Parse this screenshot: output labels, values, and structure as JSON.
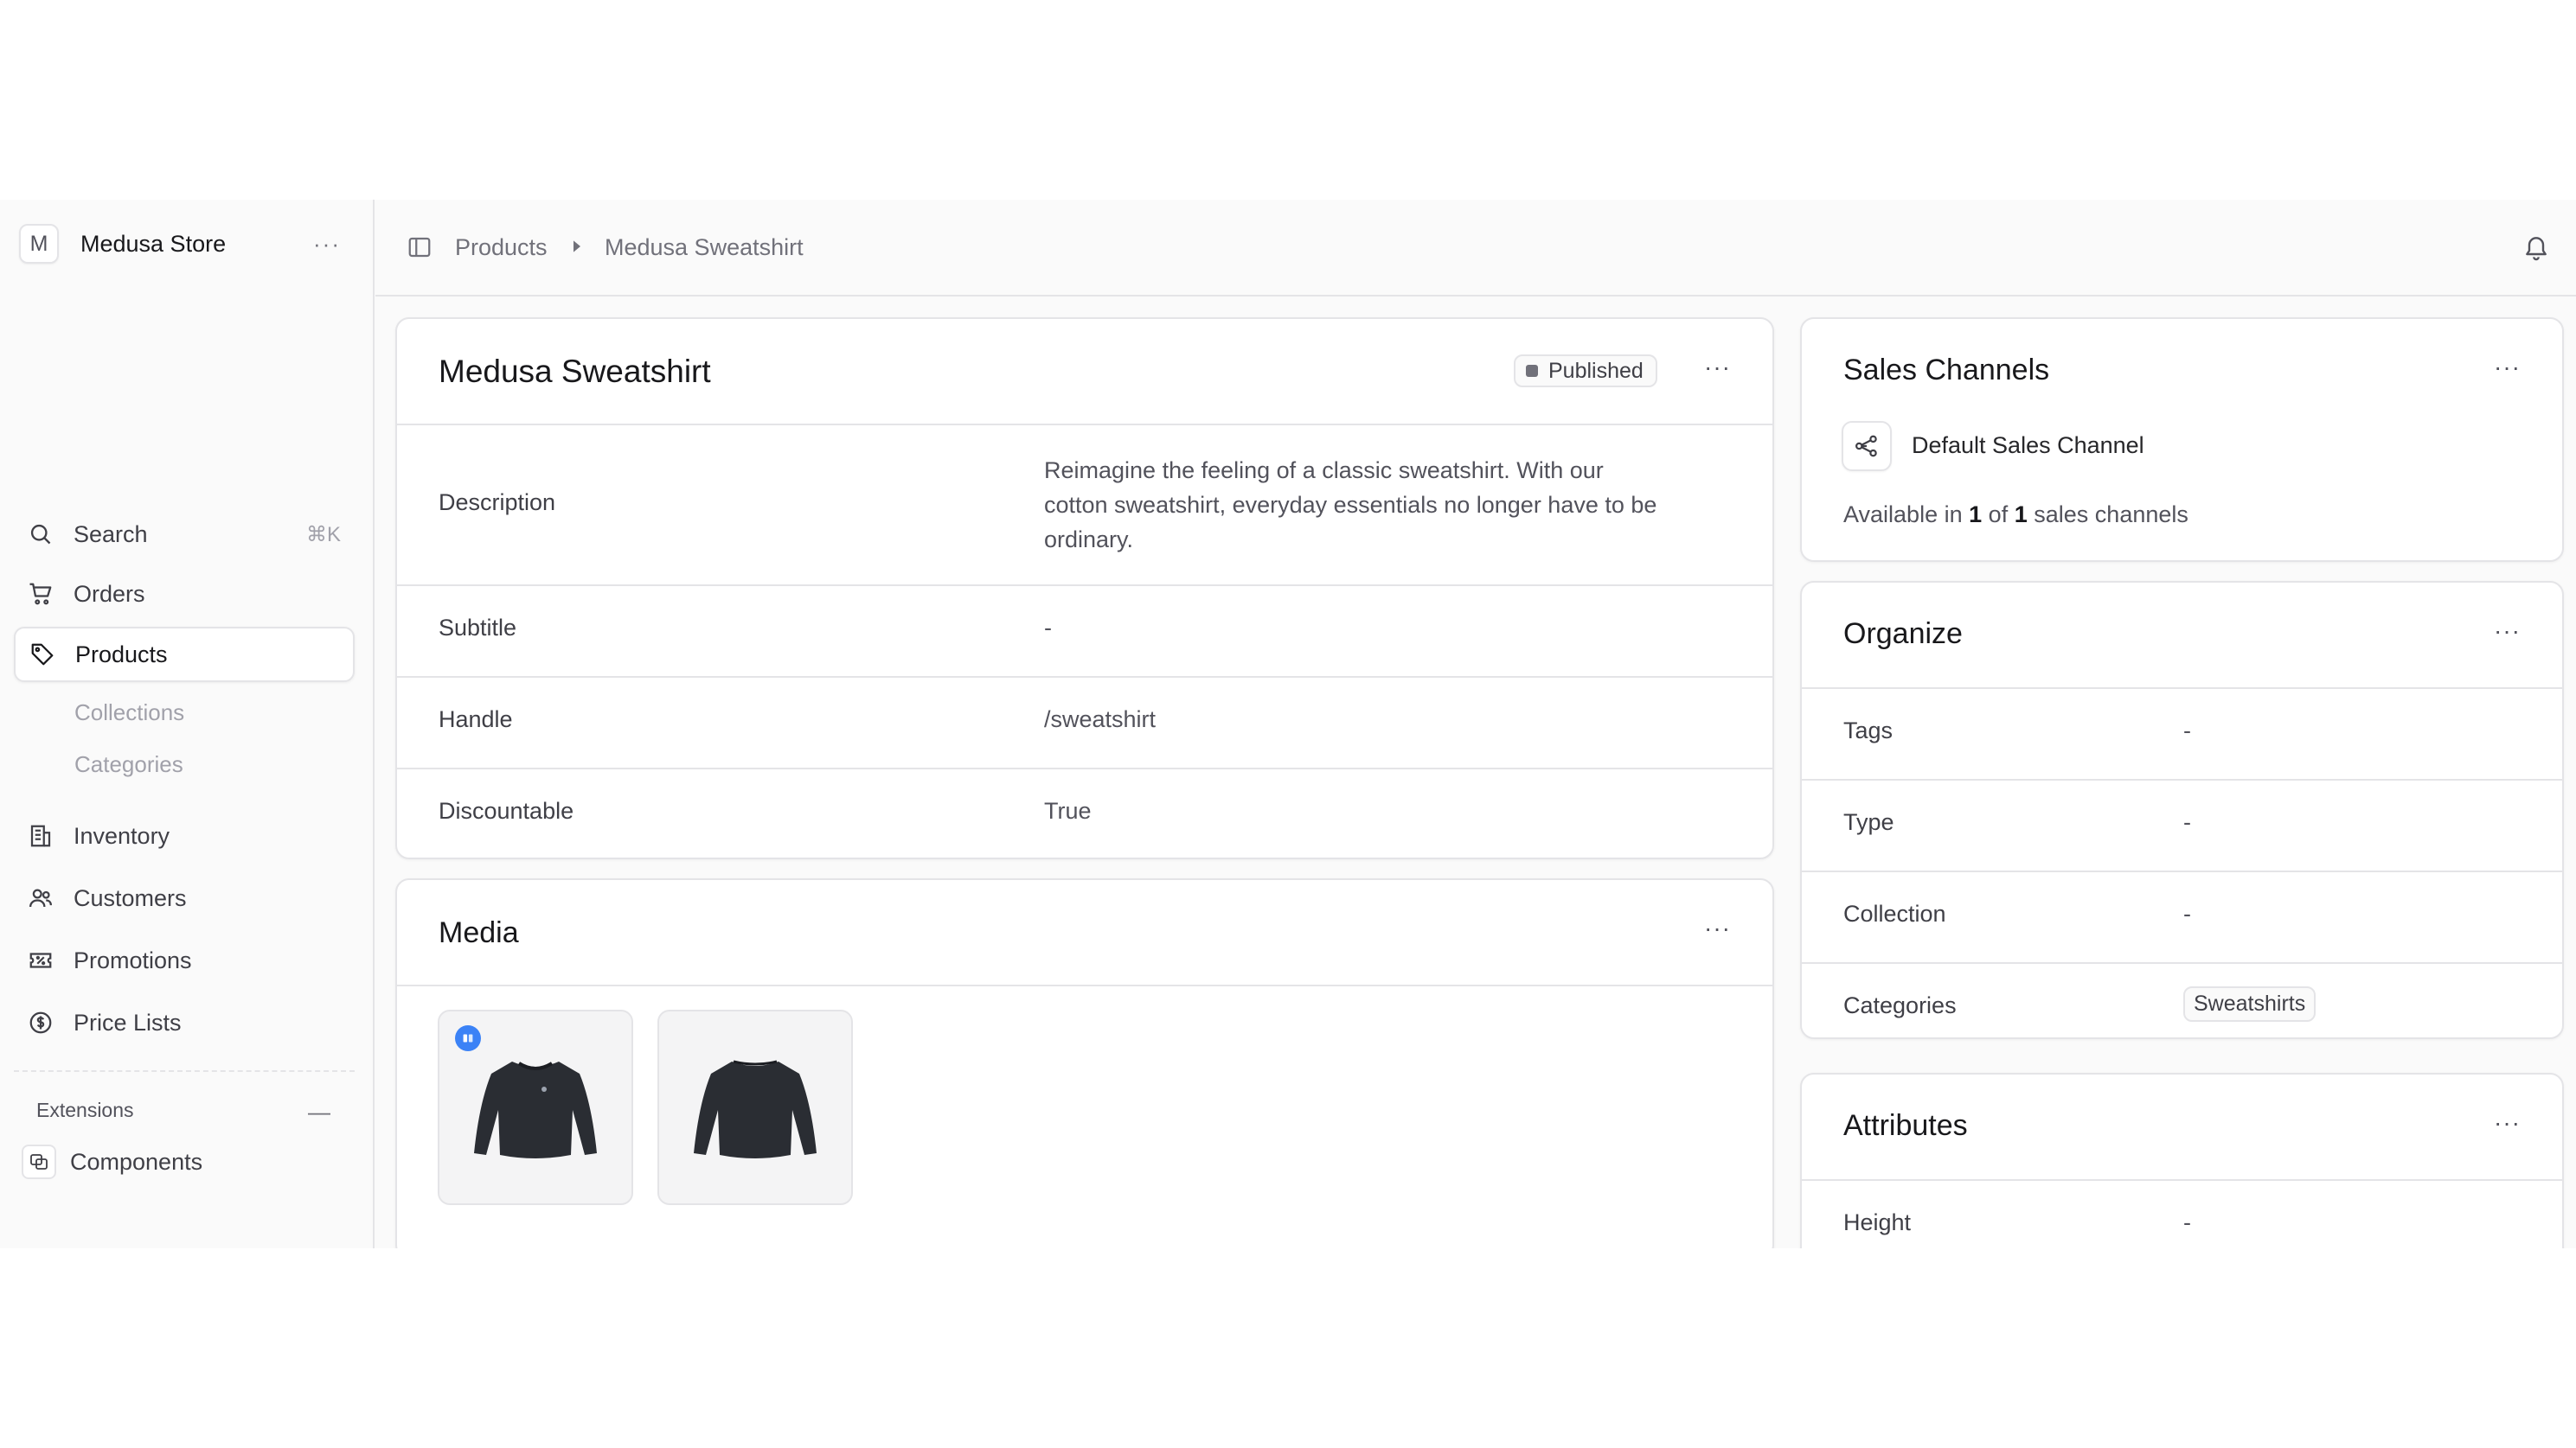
{
  "sidebar": {
    "store": {
      "initial": "M",
      "name": "Medusa Store"
    },
    "search": {
      "label": "Search",
      "shortcut": "⌘K"
    },
    "items": [
      {
        "label": "Orders",
        "icon": "cart-icon"
      },
      {
        "label": "Products",
        "icon": "tag-icon",
        "active": true
      },
      {
        "label": "Inventory",
        "icon": "building-icon"
      },
      {
        "label": "Customers",
        "icon": "users-icon"
      },
      {
        "label": "Promotions",
        "icon": "receipt-percent-icon"
      },
      {
        "label": "Price Lists",
        "icon": "currency-dollar-icon"
      }
    ],
    "product_subitems": [
      "Collections",
      "Categories"
    ],
    "extensions": {
      "label": "Extensions",
      "items": [
        {
          "label": "Components",
          "icon": "components-icon"
        }
      ]
    }
  },
  "header": {
    "breadcrumb": [
      "Products",
      "Medusa Sweatshirt"
    ]
  },
  "product": {
    "title": "Medusa Sweatshirt",
    "status": "Published",
    "fields": {
      "description_label": "Description",
      "description": "Reimagine the feeling of a classic sweatshirt. With our cotton sweatshirt, everyday essentials no longer have to be ordinary.",
      "subtitle_label": "Subtitle",
      "subtitle": "-",
      "handle_label": "Handle",
      "handle": "/sweatshirt",
      "discountable_label": "Discountable",
      "discountable": "True"
    }
  },
  "media": {
    "title": "Media",
    "images": [
      "front-view",
      "back-view"
    ]
  },
  "sales_channels": {
    "title": "Sales Channels",
    "channel": "Default Sales Channel",
    "available_prefix": "Available in",
    "available_count": "1",
    "available_of": "of",
    "available_total": "1",
    "available_suffix": "sales channels"
  },
  "organize": {
    "title": "Organize",
    "rows": [
      {
        "label": "Tags",
        "value": "-"
      },
      {
        "label": "Type",
        "value": "-"
      },
      {
        "label": "Collection",
        "value": "-"
      },
      {
        "label": "Categories",
        "value": "Sweatshirts"
      }
    ]
  },
  "attributes": {
    "title": "Attributes",
    "rows": [
      {
        "label": "Height",
        "value": "-"
      }
    ]
  },
  "colors": {
    "accent": "#3b82f6",
    "border": "#e4e4e7",
    "sidebar_bg": "#fafafa"
  }
}
